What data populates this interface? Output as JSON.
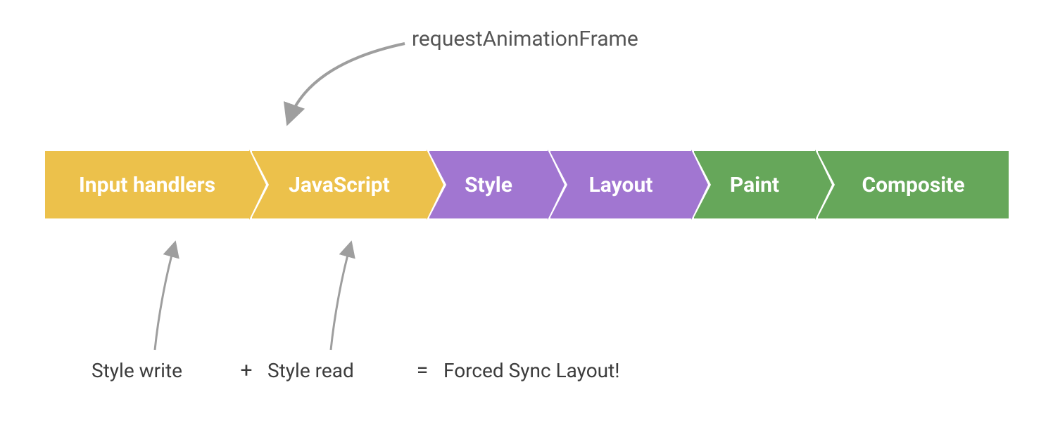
{
  "annotations": {
    "top": "requestAnimationFrame",
    "bottom": {
      "style_write": "Style write",
      "plus": "+",
      "style_read": "Style read",
      "equals": "=",
      "forced_sync_layout": "Forced Sync Layout!"
    }
  },
  "pipeline": {
    "steps": [
      {
        "label": "Input handlers",
        "color": "yellow"
      },
      {
        "label": "JavaScript",
        "color": "yellow"
      },
      {
        "label": "Style",
        "color": "purple"
      },
      {
        "label": "Layout",
        "color": "purple"
      },
      {
        "label": "Paint",
        "color": "green"
      },
      {
        "label": "Composite",
        "color": "green"
      }
    ]
  },
  "colors": {
    "yellow": "#ecc14b",
    "purple": "#a176d1",
    "green": "#66a75a",
    "arrow": "#9e9e9e",
    "text": "#3c3c3c"
  },
  "arrows": {
    "raf_to_js": {
      "from": "requestAnimationFrame label",
      "to": "between Input handlers and JavaScript (start of JS step)"
    },
    "style_write_to_input": {
      "from": "Style write label",
      "to": "Input handlers step"
    },
    "style_read_to_js": {
      "from": "Style read label",
      "to": "JavaScript step"
    }
  }
}
